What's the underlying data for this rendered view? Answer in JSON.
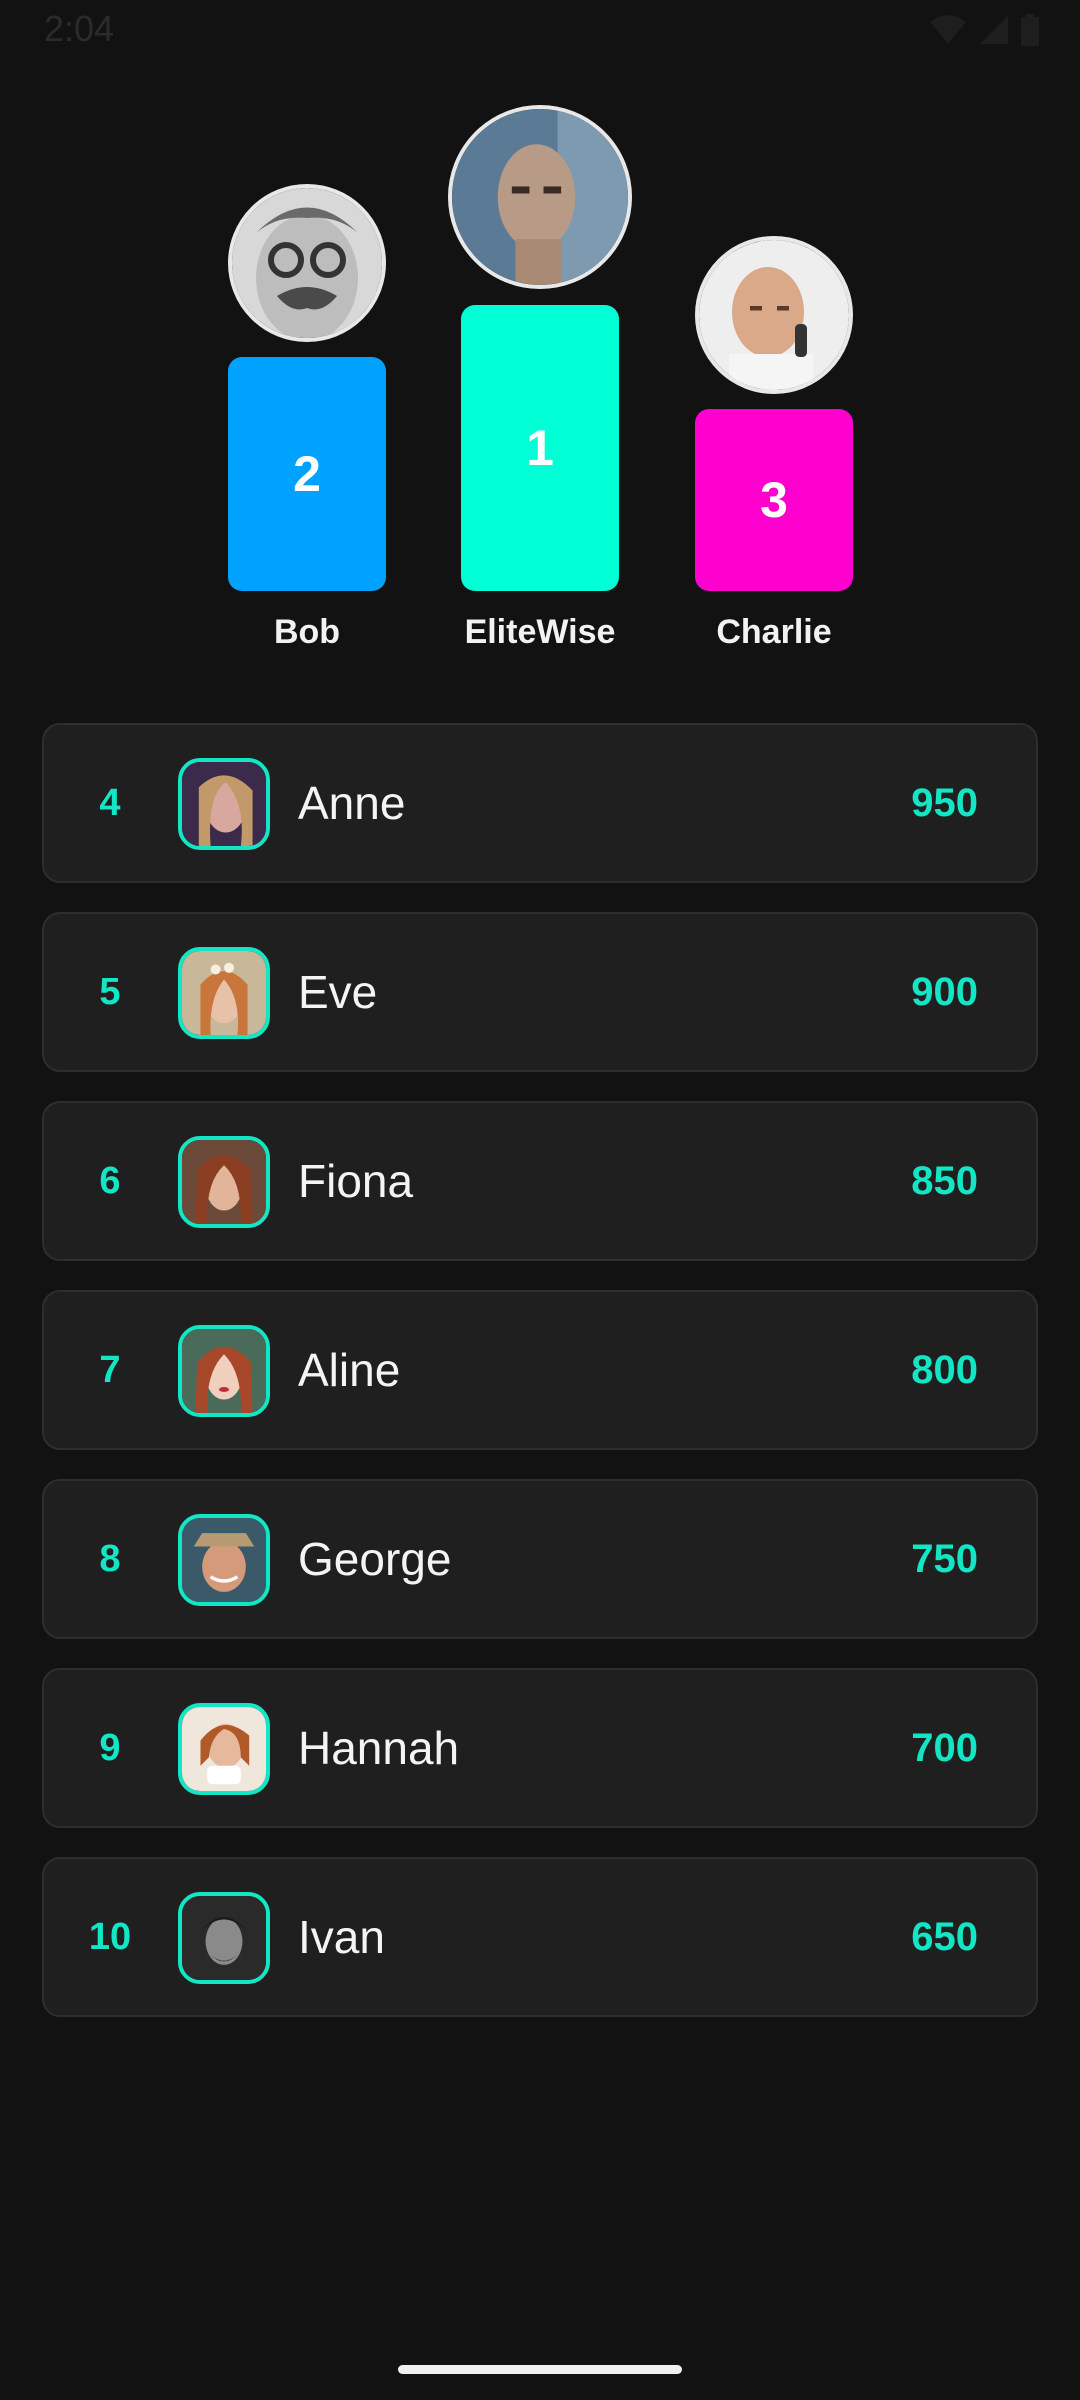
{
  "status_bar": {
    "time": "2:04",
    "icons": [
      "wifi-icon",
      "cell-signal-icon",
      "battery-icon"
    ]
  },
  "colors": {
    "background": "#121212",
    "accent": "#12e6c4",
    "rank1_bar": "#00ffd5",
    "rank2_bar": "#00a2ff",
    "rank3_bar": "#ff00cf",
    "row_background": "#1f1f1f"
  },
  "podium": {
    "first": {
      "rank": "1",
      "name": "EliteWise"
    },
    "second": {
      "rank": "2",
      "name": "Bob"
    },
    "third": {
      "rank": "3",
      "name": "Charlie"
    }
  },
  "leaderboard": [
    {
      "rank": "4",
      "name": "Anne",
      "score": "950"
    },
    {
      "rank": "5",
      "name": "Eve",
      "score": "900"
    },
    {
      "rank": "6",
      "name": "Fiona",
      "score": "850"
    },
    {
      "rank": "7",
      "name": "Aline",
      "score": "800"
    },
    {
      "rank": "8",
      "name": "George",
      "score": "750"
    },
    {
      "rank": "9",
      "name": "Hannah",
      "score": "700"
    },
    {
      "rank": "10",
      "name": "Ivan",
      "score": "650"
    }
  ]
}
